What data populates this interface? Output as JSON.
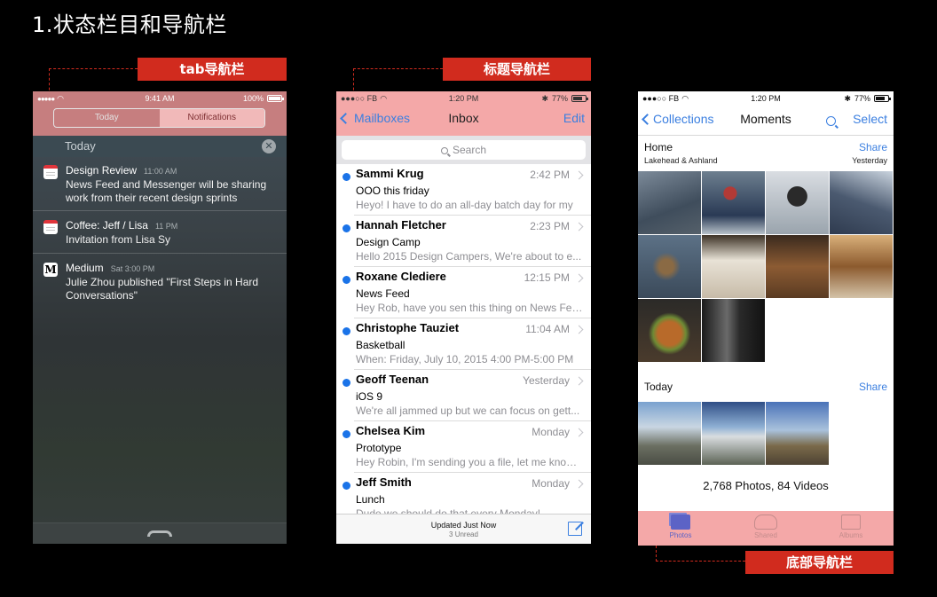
{
  "heading": "1.状态栏目和导航栏",
  "tags": {
    "tab": "tab导航栏",
    "title": "标题导航栏",
    "bottom": "底部导航栏"
  },
  "phone1": {
    "status": {
      "dots": "●●●●●",
      "time": "9:41 AM",
      "battery": "100%"
    },
    "tabs": [
      "Today",
      "Notifications"
    ],
    "section": "Today",
    "notifications": [
      {
        "icon": "calendar-icon",
        "title": "Design Review",
        "time": "11:00 AM",
        "body": "News Feed and Messenger will be sharing work from their recent design sprints"
      },
      {
        "icon": "calendar-icon",
        "title": "Coffee: Jeff / Lisa",
        "time": "11 PM",
        "body": "Invitation from Lisa Sy"
      },
      {
        "icon": "medium-icon",
        "title": "Medium",
        "time": "Sat 3:00 PM",
        "body": "Julie Zhou published \"First Steps in Hard Conversations\""
      }
    ],
    "medium_letter": "M"
  },
  "phone2": {
    "status": {
      "carrier": "●●●○○ FB",
      "time": "1:20 PM",
      "battery": "77%"
    },
    "nav": {
      "back": "Mailboxes",
      "title": "Inbox",
      "edit": "Edit"
    },
    "search_placeholder": "Search",
    "mails": [
      {
        "sender": "Sammi Krug",
        "when": "2:42 PM",
        "subject": "OOO this friday",
        "preview": "Heyo! I have to do an all-day batch day for my"
      },
      {
        "sender": "Hannah Fletcher",
        "when": "2:23 PM",
        "subject": "Design Camp",
        "preview": "Hello 2015 Design Campers, We're about to e..."
      },
      {
        "sender": "Roxane Clediere",
        "when": "12:15 PM",
        "subject": "News Feed",
        "preview": "Hey Rob, have you sen this thing on News Fee..."
      },
      {
        "sender": "Christophe Tauziet",
        "when": "11:04 AM",
        "subject": "Basketball",
        "preview": "When: Friday, July 10, 2015 4:00 PM-5:00 PM"
      },
      {
        "sender": "Geoff Teenan",
        "when": "Yesterday",
        "subject": "iOS 9",
        "preview": "We're all jammed up but we can focus on gett..."
      },
      {
        "sender": "Chelsea Kim",
        "when": "Monday",
        "subject": "Prototype",
        "preview": "Hey Robin, I'm sending you a file, let me know ..."
      },
      {
        "sender": "Jeff Smith",
        "when": "Monday",
        "subject": "Lunch",
        "preview": "Dude we should do that every Monday!"
      }
    ],
    "footer": {
      "updated": "Updated Just Now",
      "unread": "3 Unread"
    }
  },
  "phone3": {
    "status": {
      "carrier": "●●●○○ FB",
      "time": "1:20 PM",
      "battery": "77%"
    },
    "nav": {
      "back": "Collections",
      "title": "Moments",
      "select": "Select"
    },
    "home": {
      "title": "Home",
      "subtitle": "Lakehead & Ashland",
      "share": "Share",
      "date": "Yesterday"
    },
    "today": {
      "title": "Today",
      "share": "Share"
    },
    "count": "2,768 Photos, 84 Videos",
    "tabs": [
      "Photos",
      "Shared",
      "Albums"
    ],
    "colors": {
      "accent": "#3b7fe0",
      "tab_active": "#5c63c6"
    }
  }
}
